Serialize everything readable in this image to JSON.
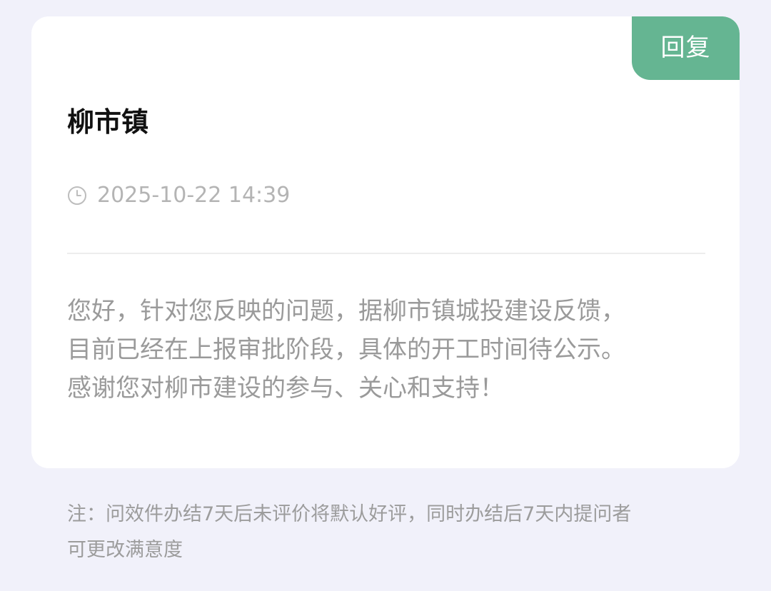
{
  "card": {
    "badge_label": "回复",
    "title": "柳市镇",
    "time_icon": "clock-icon",
    "timestamp": "2025-10-22 14:39",
    "content_lines": [
      "您好，针对您反映的问题，据柳市镇城投建设反馈，",
      "目前已经在上报审批阶段，具体的开工时间待公示。",
      "感谢您对柳市建设的参与、关心和支持！"
    ]
  },
  "note_lines": [
    "注：问效件办结7天后未评价将默认好评，同时办结后7天内提问者",
    "可更改满意度"
  ],
  "colors": {
    "background": "#f1f1fa",
    "badge": "#65b592",
    "muted_text": "#9a9a9a"
  }
}
